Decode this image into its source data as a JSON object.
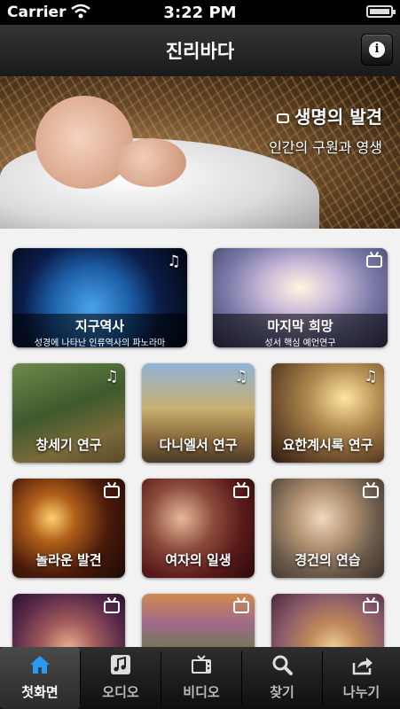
{
  "status_bar": {
    "carrier": "Carrier",
    "time": "3:22 PM"
  },
  "nav": {
    "title": "진리바다",
    "info_icon": "info-icon"
  },
  "hero": {
    "title": "생명의 발견",
    "subtitle": "인간의 구원과 영생",
    "badge_icon": "tv-icon"
  },
  "tiles": [
    {
      "title": "지구역사",
      "subtitle": "성경에 나타난 인류역사의 파노라마",
      "media": "audio"
    },
    {
      "title": "마지막 희망",
      "subtitle": "성서 핵심 예언연구",
      "media": "video"
    },
    {
      "title": "창세기 연구",
      "media": "audio"
    },
    {
      "title": "다니엘서 연구",
      "media": "audio"
    },
    {
      "title": "요한계시록 연구",
      "media": "audio"
    },
    {
      "title": "놀라운 발견",
      "media": "video"
    },
    {
      "title": "여자의 일생",
      "media": "video"
    },
    {
      "title": "경건의 연습",
      "media": "video"
    },
    {
      "title": "",
      "media": "video"
    },
    {
      "title": "",
      "media": "video"
    },
    {
      "title": "",
      "media": "video"
    }
  ],
  "tabbar": {
    "items": [
      {
        "label": "첫화면",
        "icon": "home-icon",
        "active": true
      },
      {
        "label": "오디오",
        "icon": "music-icon",
        "active": false
      },
      {
        "label": "비디오",
        "icon": "tv-icon",
        "active": false
      },
      {
        "label": "찾기",
        "icon": "search-icon",
        "active": false
      },
      {
        "label": "나누기",
        "icon": "share-icon",
        "active": false
      }
    ],
    "active_color": "#2a9bf0"
  }
}
